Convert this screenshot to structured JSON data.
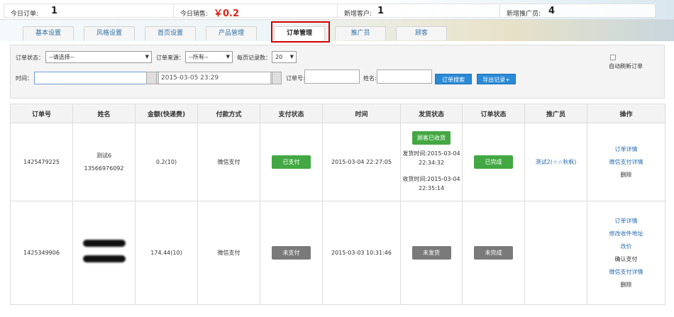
{
  "stats": [
    {
      "label": "今日订单:",
      "value": "1",
      "color": ""
    },
    {
      "label": "今日销售:",
      "value": "￥0.2",
      "color": "#e0241b"
    },
    {
      "label": "新增客户:",
      "value": "1",
      "color": ""
    },
    {
      "label": "新增推广员:",
      "value": "4",
      "color": ""
    }
  ],
  "tabs": [
    {
      "label": "基本设置"
    },
    {
      "label": "风格设置"
    },
    {
      "label": "首页设置"
    },
    {
      "label": "产品管理"
    },
    {
      "label": "订单管理",
      "active": true
    },
    {
      "label": "推广员"
    },
    {
      "label": "顾客"
    }
  ],
  "filter": {
    "order_status_label": "订单状态：",
    "order_status_value": "--请选择--",
    "order_source_label": "订单来源：",
    "order_source_value": "--所有--",
    "page_size_label": "每页记录数：",
    "page_size_value": "20",
    "time_label": "时间：",
    "time_start": "",
    "time_end": "2015-03-05 23:29",
    "order_no_label": "订单号:",
    "order_no_value": "",
    "name_label": "姓名:",
    "name_value": "",
    "search_button": "订单搜索",
    "export_button": "导出记录+",
    "auto_refresh_label": "自动刷新订单"
  },
  "table": {
    "headers": [
      "订单号",
      "姓名",
      "金额(快递费)",
      "付款方式",
      "支付状态",
      "时间",
      "发货状态",
      "订单状态",
      "推广员",
      "操作"
    ],
    "rows": [
      {
        "order_no": "1425479225",
        "name_line1": "测试6",
        "name_line2": "13566976092",
        "amount": "0.2(10)",
        "payment_method": "微信支付",
        "pay_status": "已支付",
        "time": "2015-03-04 22:27:05",
        "ship_status": "顾客已收货",
        "ship_time": "发货时间:2015-03-04 22:34:32",
        "receive_time": "收货时间:2015-03-04 22:35:14",
        "order_status": "已完成",
        "promoter": "测试2(☆☆秋枫)",
        "actions": [
          {
            "label": "订单详情",
            "link": true
          },
          {
            "label": "微信支付详情",
            "link": true
          },
          {
            "label": "删除",
            "link": false
          }
        ]
      },
      {
        "order_no": "1425349906",
        "amount": "174.44(10)",
        "payment_method": "微信支付",
        "pay_status": "未支付",
        "time": "2015-03-03 10:31:46",
        "ship_status": "未发货",
        "order_status": "未完成",
        "promoter": "",
        "actions": [
          {
            "label": "订单详情",
            "link": true
          },
          {
            "label": "修改收件地址",
            "link": true
          },
          {
            "label": "改价",
            "link": true
          },
          {
            "label": "确认支付",
            "link": false
          },
          {
            "label": "微信支付详情",
            "link": true
          },
          {
            "label": "删除",
            "link": false
          }
        ]
      }
    ]
  }
}
